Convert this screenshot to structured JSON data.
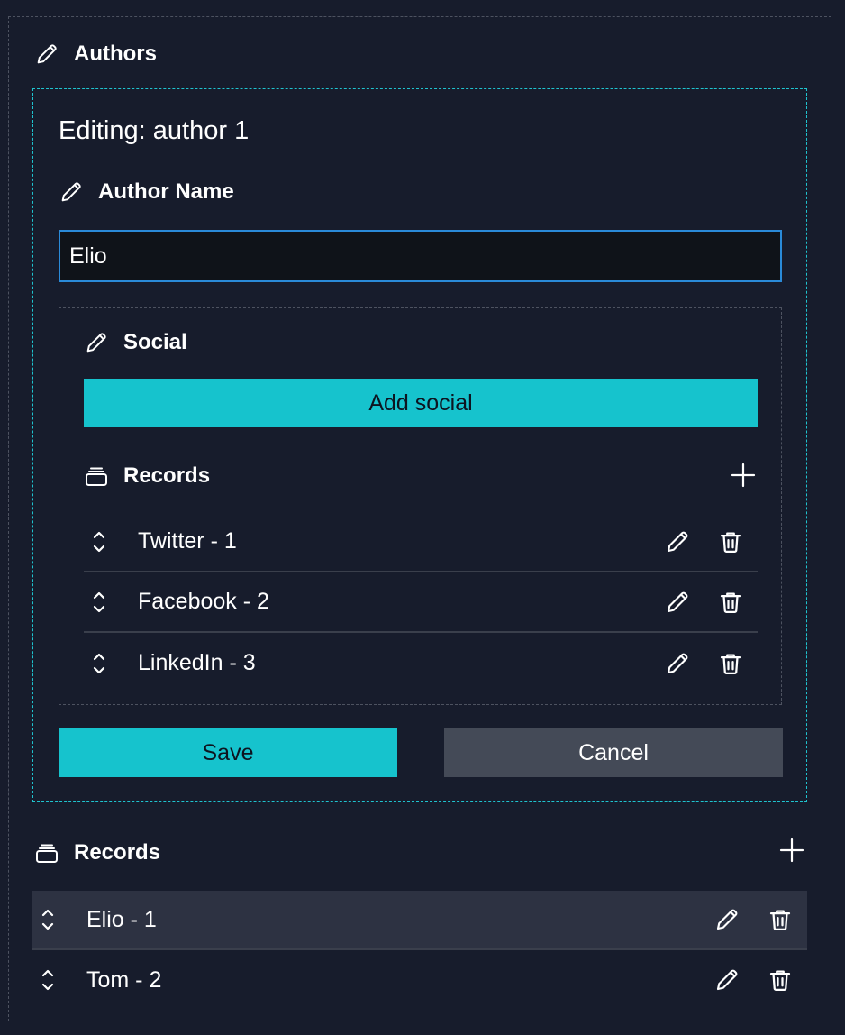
{
  "authors": {
    "title": "Authors",
    "editor": {
      "editing_title": "Editing: author 1",
      "name_label": "Author Name",
      "name_value": "Elio",
      "social": {
        "title": "Social",
        "add_label": "Add social",
        "records_title": "Records",
        "records": [
          {
            "label": "Twitter - 1"
          },
          {
            "label": "Facebook - 2"
          },
          {
            "label": "LinkedIn - 3"
          }
        ]
      },
      "save_label": "Save",
      "cancel_label": "Cancel"
    },
    "records_title": "Records",
    "records": [
      {
        "label": "Elio - 1",
        "selected": true
      },
      {
        "label": "Tom - 2",
        "selected": false
      }
    ]
  },
  "colors": {
    "background": "#171c2c",
    "accent": "#16c3cd",
    "input_border": "#2a8ad8",
    "selected_row": "#2d3242",
    "cancel_button": "#444a57"
  },
  "icons": {
    "edit": "pencil-icon",
    "delete": "trash-icon",
    "reorder": "chevron-up-down-icon",
    "records": "stack-icon",
    "add": "plus-icon"
  }
}
